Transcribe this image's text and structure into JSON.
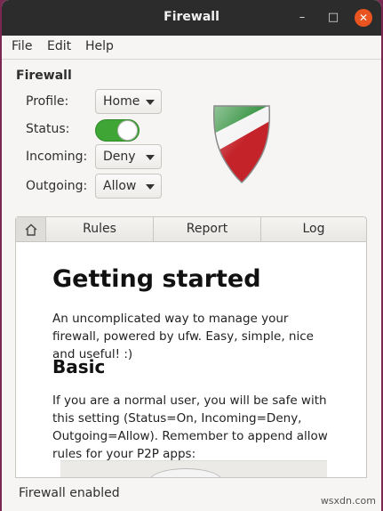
{
  "window": {
    "title": "Firewall"
  },
  "window_controls": {
    "minimize": "–",
    "maximize": "□",
    "close": "✕"
  },
  "menu": {
    "file": "File",
    "edit": "Edit",
    "help": "Help"
  },
  "section_heading": "Firewall",
  "profile": {
    "label": "Profile:",
    "value": "Home"
  },
  "status": {
    "label": "Status:",
    "on": true
  },
  "incoming": {
    "label": "Incoming:",
    "value": "Deny"
  },
  "outgoing": {
    "label": "Outgoing:",
    "value": "Allow"
  },
  "shield_colors": {
    "green": "#2f8f3a",
    "white": "#f4f4f4",
    "red": "#c4232a"
  },
  "tabs": {
    "home_icon": "home-icon",
    "rules": "Rules",
    "report": "Report",
    "log": "Log"
  },
  "content": {
    "title": "Getting started",
    "intro": "An uncomplicated way to manage your firewall, powered by ufw. Easy, simple, nice and useful! :)",
    "basic_heading": "Basic",
    "basic_text": "If you are a normal user, you will be safe with this setting (Status=On, Incoming=Deny, Outgoing=Allow). Remember to append allow rules for your P2P apps:"
  },
  "statusbar": "Firewall enabled",
  "watermark": "wsxdn.com"
}
